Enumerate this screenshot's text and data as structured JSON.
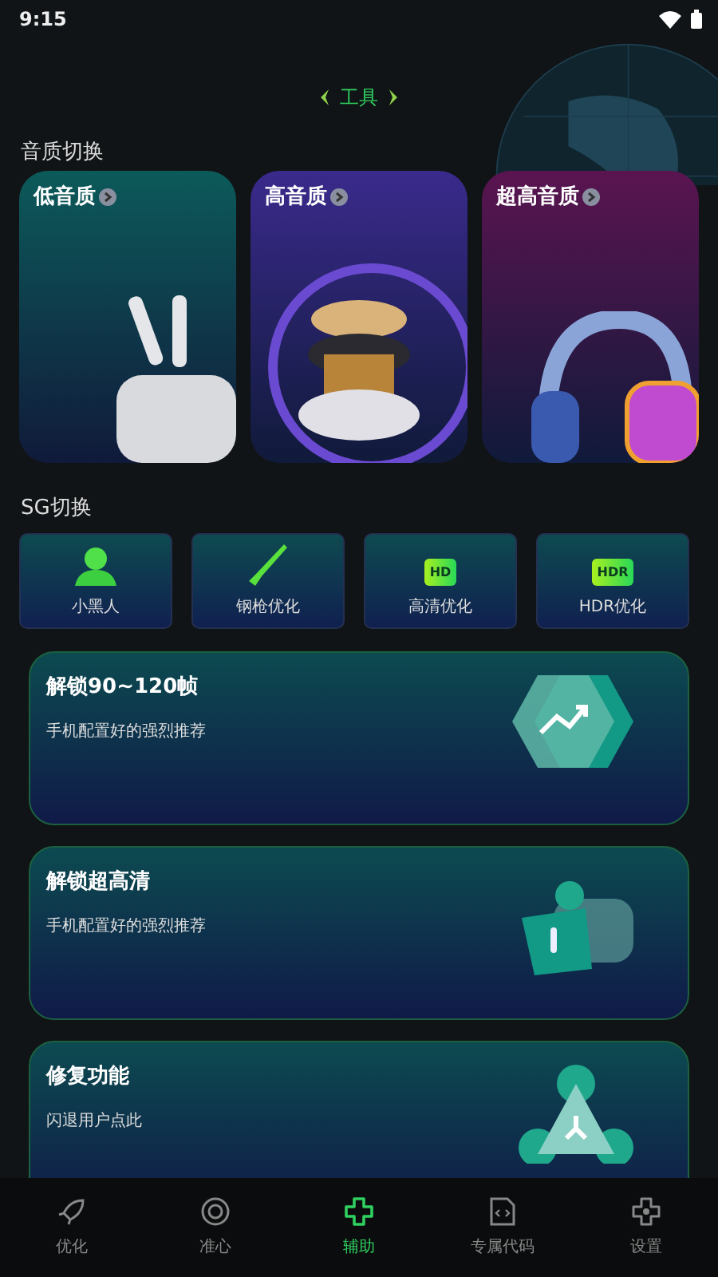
{
  "status_bar": {
    "time": "9:15"
  },
  "header": {
    "title": "工具"
  },
  "quality": {
    "title": "音质切换",
    "cards": [
      {
        "label": "低音质",
        "color": "#0c5a5a",
        "kind": "earbuds"
      },
      {
        "label": "高音质",
        "color": "#3a2a8c",
        "kind": "speaker"
      },
      {
        "label": "超高音质",
        "color": "#5a1450",
        "kind": "headphones"
      }
    ]
  },
  "sg": {
    "title": "SG切换",
    "items": [
      {
        "label": "小黑人",
        "kind": "person"
      },
      {
        "label": "钢枪优化",
        "kind": "rifle"
      },
      {
        "label": "高清优化",
        "kind": "badge",
        "badge": "HD"
      },
      {
        "label": "HDR优化",
        "kind": "badge",
        "badge": "HDR"
      }
    ]
  },
  "features": [
    {
      "title": "解锁90~120帧",
      "subtitle": "手机配置好的强烈推荐",
      "kind": "trend"
    },
    {
      "title": "解锁超高清",
      "subtitle": "手机配置好的强烈推荐",
      "kind": "thumb"
    },
    {
      "title": "修复功能",
      "subtitle": "闪退用户点此",
      "kind": "nodes"
    }
  ],
  "nav": [
    {
      "label": "优化",
      "selected": false,
      "kind": "rocket"
    },
    {
      "label": "准心",
      "selected": false,
      "kind": "target"
    },
    {
      "label": "辅助",
      "selected": true,
      "kind": "assist"
    },
    {
      "label": "专属代码",
      "selected": false,
      "kind": "code"
    },
    {
      "label": "设置",
      "selected": false,
      "kind": "settings"
    }
  ]
}
